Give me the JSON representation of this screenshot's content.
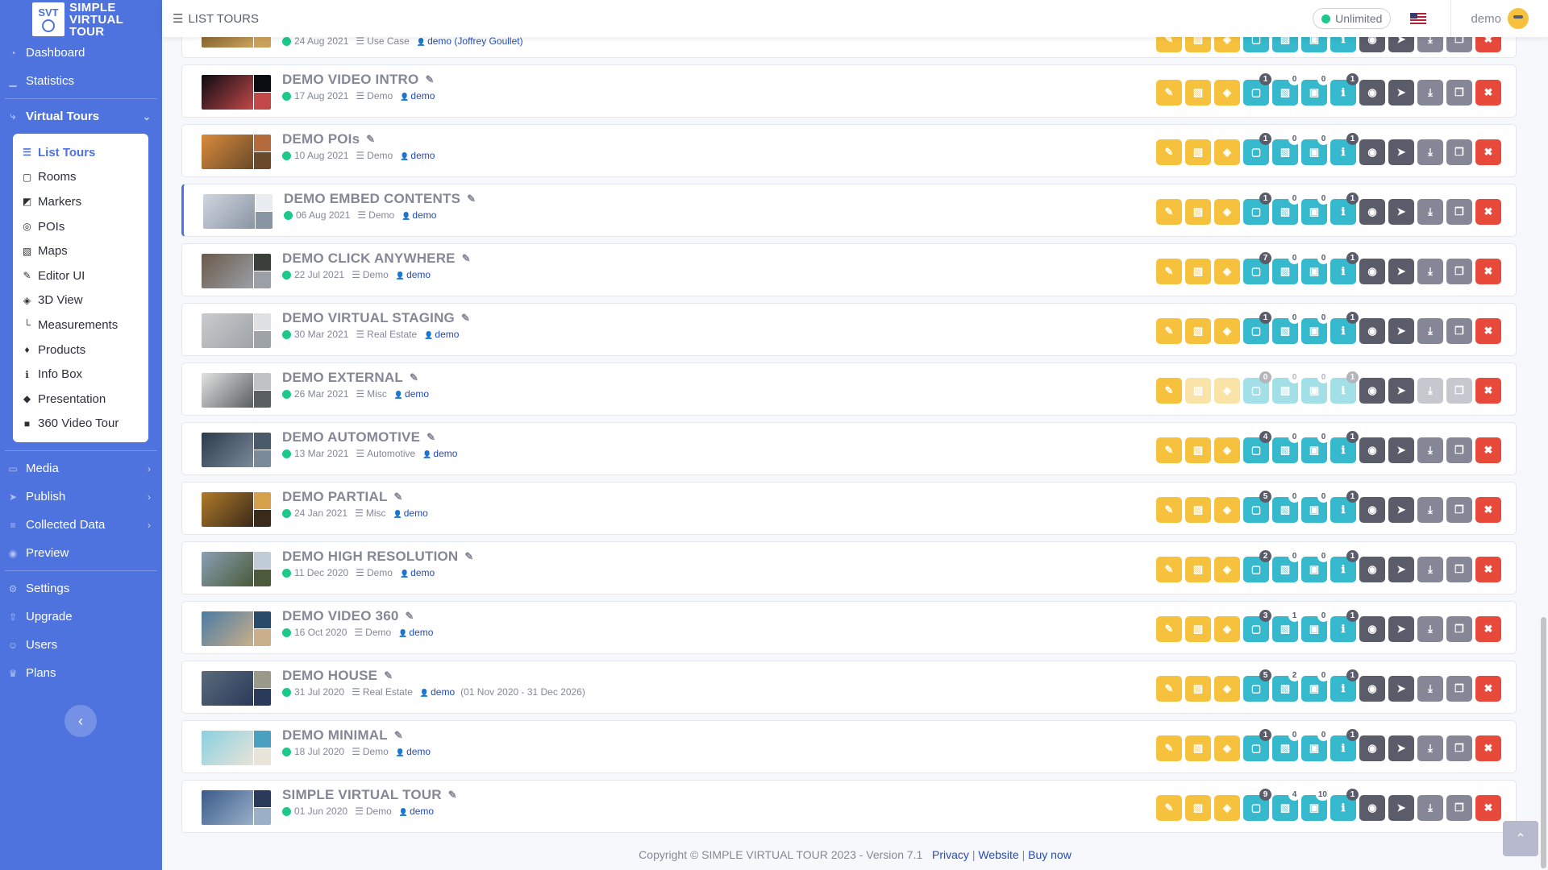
{
  "brand": {
    "logo_text": "SVT",
    "line1": "SIMPLE",
    "line2": "VIRTUAL",
    "line3": "TOUR"
  },
  "topbar": {
    "title": "LIST TOURS",
    "plan": "Unlimited",
    "user": "demo"
  },
  "sidebar": {
    "items": [
      {
        "label": "Dashboard",
        "icon": "dashboard-icon"
      },
      {
        "label": "Statistics",
        "icon": "chart-icon"
      },
      {
        "label": "Virtual Tours",
        "icon": "route-icon"
      }
    ],
    "submenu": [
      {
        "label": "List Tours",
        "icon": "list-icon"
      },
      {
        "label": "Rooms",
        "icon": "vector-icon"
      },
      {
        "label": "Markers",
        "icon": "caret-icon"
      },
      {
        "label": "POIs",
        "icon": "bullseye-icon"
      },
      {
        "label": "Maps",
        "icon": "map-icon"
      },
      {
        "label": "Editor UI",
        "icon": "brush-icon"
      },
      {
        "label": "3D View",
        "icon": "cube-icon"
      },
      {
        "label": "Measurements",
        "icon": "ruler-icon"
      },
      {
        "label": "Products",
        "icon": "cart-icon"
      },
      {
        "label": "Info Box",
        "icon": "info-icon"
      },
      {
        "label": "Presentation",
        "icon": "diamond-icon"
      },
      {
        "label": "360 Video Tour",
        "icon": "video-icon"
      }
    ],
    "items2": [
      {
        "label": "Media",
        "icon": "media-icon"
      },
      {
        "label": "Publish",
        "icon": "publish-icon"
      },
      {
        "label": "Collected Data",
        "icon": "database-icon"
      },
      {
        "label": "Preview",
        "icon": "eye-icon"
      }
    ],
    "items3": [
      {
        "label": "Settings",
        "icon": "gear-icon"
      },
      {
        "label": "Upgrade",
        "icon": "upgrade-icon"
      },
      {
        "label": "Users",
        "icon": "users-icon"
      },
      {
        "label": "Plans",
        "icon": "crown-icon"
      }
    ]
  },
  "tours": [
    {
      "name": "",
      "date": "24 Aug 2021",
      "category": "Use Case",
      "author": "demo (Joffrey Goullet)",
      "extra": "",
      "badges": [
        "",
        "",
        "",
        ""
      ],
      "colors": [
        "#7a5b2a",
        "#c9a15a",
        "#3a4048"
      ],
      "faded": false
    },
    {
      "name": "DEMO VIDEO INTRO",
      "date": "17 Aug 2021",
      "category": "Demo",
      "author": "demo",
      "extra": "",
      "badges": [
        "1",
        "0",
        "0",
        "1"
      ],
      "colors": [
        "#0b0b12",
        "#c2484a",
        "#0b0b12"
      ],
      "faded": false
    },
    {
      "name": "DEMO POIs",
      "date": "10 Aug 2021",
      "category": "Demo",
      "author": "demo",
      "extra": "",
      "badges": [
        "1",
        "0",
        "0",
        "1"
      ],
      "colors": [
        "#d98a3a",
        "#6a4a2a",
        "#b46a3a"
      ],
      "faded": false
    },
    {
      "name": "DEMO EMBED CONTENTS",
      "date": "06 Aug 2021",
      "category": "Demo",
      "author": "demo",
      "extra": "",
      "badges": [
        "1",
        "0",
        "0",
        "1"
      ],
      "colors": [
        "#cfd6df",
        "#8a95a3",
        "#e9edf2"
      ],
      "faded": false,
      "selected": true
    },
    {
      "name": "DEMO CLICK ANYWHERE",
      "date": "22 Jul 2021",
      "category": "Demo",
      "author": "demo",
      "extra": "",
      "badges": [
        "7",
        "0",
        "0",
        "1"
      ],
      "colors": [
        "#6a5a4a",
        "#9aa0a6",
        "#3a3f3a"
      ],
      "faded": false
    },
    {
      "name": "DEMO VIRTUAL STAGING",
      "date": "30 Mar 2021",
      "category": "Real Estate",
      "author": "demo",
      "extra": "",
      "badges": [
        "1",
        "0",
        "0",
        "1"
      ],
      "colors": [
        "#c9ccce",
        "#9ea3a7",
        "#dfe2e4"
      ],
      "faded": false
    },
    {
      "name": "DEMO EXTERNAL",
      "date": "26 Mar 2021",
      "category": "Misc",
      "author": "demo",
      "extra": "",
      "badges": [
        "0",
        "0",
        "0",
        "1"
      ],
      "colors": [
        "#e2e2e2",
        "#5a5f60",
        "#bfc3c4"
      ],
      "faded": true
    },
    {
      "name": "DEMO AUTOMOTIVE",
      "date": "13 Mar 2021",
      "category": "Automotive",
      "author": "demo",
      "extra": "",
      "badges": [
        "4",
        "0",
        "0",
        "1"
      ],
      "colors": [
        "#2a3a4a",
        "#7a8a9a",
        "#4a5a6a"
      ],
      "faded": false
    },
    {
      "name": "DEMO PARTIAL",
      "date": "24 Jan 2021",
      "category": "Misc",
      "author": "demo",
      "extra": "",
      "badges": [
        "5",
        "0",
        "0",
        "1"
      ],
      "colors": [
        "#b07a2a",
        "#3a2a1a",
        "#d6a04a"
      ],
      "faded": false
    },
    {
      "name": "DEMO HIGH RESOLUTION",
      "date": "11 Dec 2020",
      "category": "Demo",
      "author": "demo",
      "extra": "",
      "badges": [
        "2",
        "0",
        "0",
        "1"
      ],
      "colors": [
        "#8aa0b4",
        "#4a5a3a",
        "#c0ccd6"
      ],
      "faded": false
    },
    {
      "name": "DEMO VIDEO 360",
      "date": "16 Oct 2020",
      "category": "Demo",
      "author": "demo",
      "extra": "",
      "badges": [
        "3",
        "1",
        "0",
        "1"
      ],
      "colors": [
        "#4a7aa4",
        "#c9b08a",
        "#2a4a6a"
      ],
      "faded": false
    },
    {
      "name": "DEMO HOUSE",
      "date": "31 Jul 2020",
      "category": "Real Estate",
      "author": "demo",
      "extra": "(01 Nov 2020 - 31 Dec 2026)",
      "badges": [
        "5",
        "2",
        "0",
        "1"
      ],
      "colors": [
        "#5a6a7a",
        "#2a3a5a",
        "#9a9a8a"
      ],
      "faded": false
    },
    {
      "name": "DEMO MINIMAL",
      "date": "18 Jul 2020",
      "category": "Demo",
      "author": "demo",
      "extra": "",
      "badges": [
        "1",
        "0",
        "0",
        "1"
      ],
      "colors": [
        "#8ad0e0",
        "#e8e4d8",
        "#4aa0c0"
      ],
      "faded": false
    },
    {
      "name": "SIMPLE VIRTUAL TOUR",
      "date": "01 Jun 2020",
      "category": "Demo",
      "author": "demo",
      "extra": "",
      "badges": [
        "9",
        "4",
        "10",
        "1"
      ],
      "colors": [
        "#3a5a8a",
        "#9ab0c8",
        "#2a3a5a"
      ],
      "faded": false
    }
  ],
  "footer": {
    "copyright": "Copyright © SIMPLE VIRTUAL TOUR 2023 - Version 7.1",
    "privacy": "Privacy",
    "website": "Website",
    "buy": "Buy now"
  },
  "colors": {
    "primary": "#4e73df",
    "warning": "#f6c23e",
    "info": "#36b9cc",
    "dark": "#5a5c69",
    "secondary": "#858796",
    "danger": "#e74a3b",
    "success": "#1cc88a"
  }
}
